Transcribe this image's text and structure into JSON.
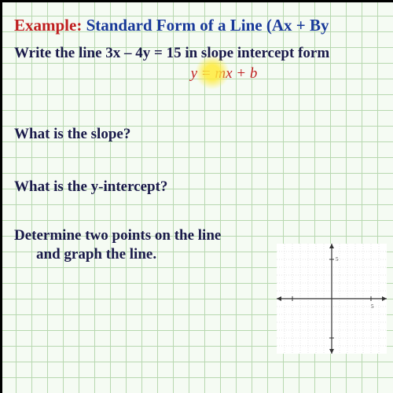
{
  "header": {
    "example_label": "Example:",
    "title": "Standard Form of a Line  (Ax + By"
  },
  "problem": "Write the line 3x – 4y = 15 in slope intercept form",
  "formula": "y = mx + b",
  "questions": {
    "q1": "What is the slope?",
    "q2": "What is the y-intercept?",
    "q3_line1": "Determine two points on the line",
    "q3_line2": "and graph the line."
  },
  "icons": {
    "highlight": "cursor-highlight"
  }
}
